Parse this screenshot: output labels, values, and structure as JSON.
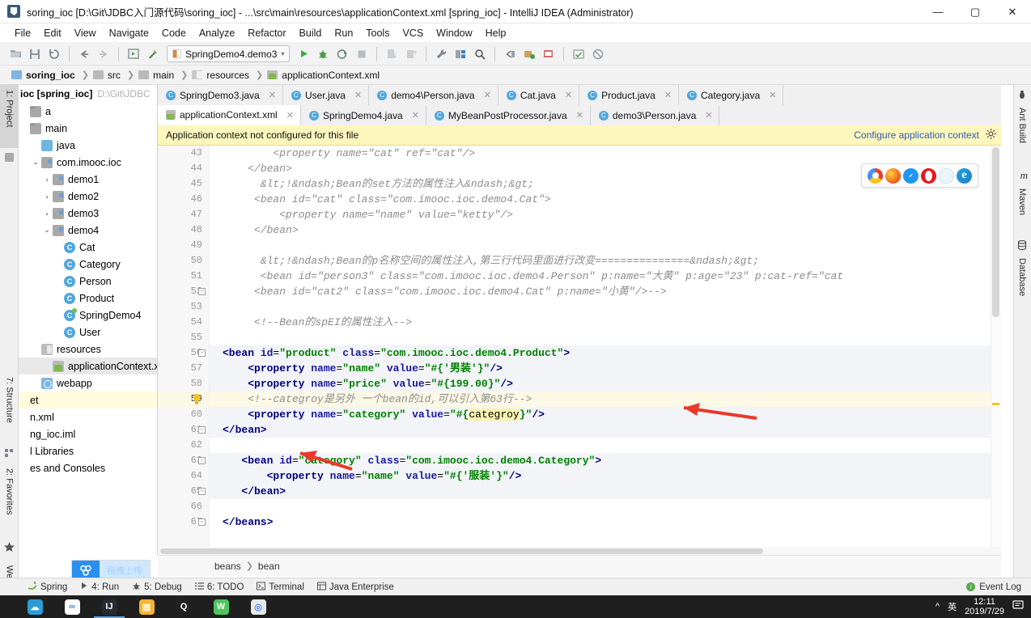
{
  "window": {
    "title": "soring_ioc [D:\\Git\\JDBC入门源代码\\soring_ioc] - ...\\src\\main\\resources\\applicationContext.xml [spring_ioc] - IntelliJ IDEA (Administrator)",
    "minimize": "—",
    "maximize": "▢",
    "close": "✕"
  },
  "menu": [
    {
      "label": "File"
    },
    {
      "label": "Edit"
    },
    {
      "label": "View"
    },
    {
      "label": "Navigate"
    },
    {
      "label": "Code"
    },
    {
      "label": "Analyze"
    },
    {
      "label": "Refactor"
    },
    {
      "label": "Build"
    },
    {
      "label": "Run"
    },
    {
      "label": "Tools"
    },
    {
      "label": "VCS"
    },
    {
      "label": "Window"
    },
    {
      "label": "Help"
    }
  ],
  "toolbar": {
    "open_icon": "open-folder-icon",
    "save_icon": "save-all-icon",
    "sync_icon": "sync-icon",
    "back_icon": "back-arrow-icon",
    "forward_icon": "forward-arrow-icon",
    "run_config_label": "SpringDemo4.demo3",
    "run_label": "▶",
    "debug_label": "debug-icon",
    "run_coverage_label": "run-coverage-icon",
    "stop_label": "■",
    "search_label": "search-icon"
  },
  "breadcrumb": [
    {
      "label": "soring_ioc",
      "icon": "module-icon",
      "bold": true
    },
    {
      "label": "src",
      "icon": "folder-icon",
      "bold": false
    },
    {
      "label": "main",
      "icon": "folder-icon",
      "bold": false
    },
    {
      "label": "resources",
      "icon": "resources-folder-icon",
      "bold": false
    },
    {
      "label": "applicationContext.xml",
      "icon": "xml-file-icon",
      "bold": false
    }
  ],
  "left_tool_tabs": [
    {
      "label": "1: Project",
      "icon": "project-icon",
      "selected": true
    },
    {
      "label": "7: Structure",
      "icon": "structure-icon",
      "selected": false
    },
    {
      "label": "2: Favorites",
      "icon": "star-icon",
      "selected": false
    },
    {
      "label": "Web",
      "icon": "web-icon",
      "selected": false
    }
  ],
  "right_tool_tabs": [
    {
      "label": "Ant Build",
      "icon": "ant-icon"
    },
    {
      "label": "Maven",
      "icon": "maven-icon"
    },
    {
      "label": "Database",
      "icon": "database-icon"
    }
  ],
  "project_tree": {
    "header_name": "ioc [spring_ioc]",
    "header_path": "D:\\Git\\JDBC",
    "items": [
      {
        "label": "a",
        "indent": 0,
        "arrow": "",
        "icon": "folder-icon",
        "state": "none"
      },
      {
        "label": "main",
        "indent": 0,
        "arrow": "",
        "icon": "folder-icon",
        "state": "none"
      },
      {
        "label": "java",
        "indent": 1,
        "arrow": "",
        "icon": "source-folder-icon",
        "state": "none"
      },
      {
        "label": "com.imooc.ioc",
        "indent": 1,
        "arrow": "v",
        "icon": "package-icon",
        "state": "none"
      },
      {
        "label": "demo1",
        "indent": 2,
        "arrow": ">",
        "icon": "package-icon",
        "state": "none"
      },
      {
        "label": "demo2",
        "indent": 2,
        "arrow": ">",
        "icon": "package-icon",
        "state": "none"
      },
      {
        "label": "demo3",
        "indent": 2,
        "arrow": ">",
        "icon": "package-icon",
        "state": "none"
      },
      {
        "label": "demo4",
        "indent": 2,
        "arrow": "v",
        "icon": "package-icon",
        "state": "none"
      },
      {
        "label": "Cat",
        "indent": 3,
        "arrow": "",
        "icon": "java-class-icon",
        "state": "none"
      },
      {
        "label": "Category",
        "indent": 3,
        "arrow": "",
        "icon": "java-class-icon",
        "state": "none"
      },
      {
        "label": "Person",
        "indent": 3,
        "arrow": "",
        "icon": "java-class-icon",
        "state": "none"
      },
      {
        "label": "Product",
        "indent": 3,
        "arrow": "",
        "icon": "java-class-icon",
        "state": "none"
      },
      {
        "label": "SpringDemo4",
        "indent": 3,
        "arrow": "",
        "icon": "java-runnable-class-icon",
        "state": "none"
      },
      {
        "label": "User",
        "indent": 3,
        "arrow": "",
        "icon": "java-class-icon",
        "state": "none"
      },
      {
        "label": "resources",
        "indent": 1,
        "arrow": "",
        "icon": "resources-folder-icon",
        "state": "none"
      },
      {
        "label": "applicationContext.xml",
        "indent": 2,
        "arrow": "",
        "icon": "xml-file-icon",
        "state": "selected"
      },
      {
        "label": "webapp",
        "indent": 1,
        "arrow": "",
        "icon": "webapp-folder-icon",
        "state": "none"
      },
      {
        "label": "et",
        "indent": 0,
        "arrow": "",
        "icon": "none",
        "state": "highlight"
      },
      {
        "label": "n.xml",
        "indent": 0,
        "arrow": "",
        "icon": "none",
        "state": "none"
      },
      {
        "label": "ng_ioc.iml",
        "indent": 0,
        "arrow": "",
        "icon": "none",
        "state": "none"
      },
      {
        "label": "l Libraries",
        "indent": 0,
        "arrow": "",
        "icon": "none",
        "state": "none"
      },
      {
        "label": "es and Consoles",
        "indent": 0,
        "arrow": "",
        "icon": "none",
        "state": "none"
      }
    ]
  },
  "editor_tabs_row1": [
    {
      "label": "SpringDemo3.java",
      "icon": "java-runnable-class-icon",
      "active": false,
      "close": "✕"
    },
    {
      "label": "User.java",
      "icon": "java-class-icon",
      "active": false,
      "close": "✕"
    },
    {
      "label": "demo4\\Person.java",
      "icon": "java-class-icon",
      "active": false,
      "close": "✕"
    },
    {
      "label": "Cat.java",
      "icon": "java-class-icon",
      "active": false,
      "close": "✕"
    },
    {
      "label": "Product.java",
      "icon": "java-class-icon",
      "active": false,
      "close": "✕"
    },
    {
      "label": "Category.java",
      "icon": "java-class-icon",
      "active": false,
      "close": "✕"
    }
  ],
  "editor_tabs_row2": [
    {
      "label": "applicationContext.xml",
      "icon": "xml-file-icon",
      "active": true,
      "close": "✕"
    },
    {
      "label": "SpringDemo4.java",
      "icon": "java-runnable-class-icon",
      "active": false,
      "close": "✕"
    },
    {
      "label": "MyBeanPostProcessor.java",
      "icon": "java-class-icon",
      "active": false,
      "close": "✕"
    },
    {
      "label": "demo3\\Person.java",
      "icon": "java-class-icon",
      "active": false,
      "close": "✕"
    }
  ],
  "notification": {
    "message": "Application context not configured for this file",
    "action": "Configure application context",
    "gear_icon": "gear-icon"
  },
  "browsers": [
    {
      "name": "chrome-icon"
    },
    {
      "name": "firefox-icon"
    },
    {
      "name": "safari-icon"
    },
    {
      "name": "opera-icon"
    },
    {
      "name": "light-browser-icon"
    },
    {
      "name": "edge-icon"
    }
  ],
  "code": {
    "first_line": 43,
    "lines": [
      {
        "n": 43,
        "state": "normal",
        "fold": "",
        "bulb": false,
        "tokens": [
          {
            "t": "        ",
            "c": "ind"
          },
          {
            "t": "<property",
            "c": "cmt"
          },
          {
            "t": " name=\"cat\" ref=\"cat\"/>",
            "c": "cmt"
          }
        ]
      },
      {
        "n": 44,
        "state": "normal",
        "fold": "",
        "bulb": false,
        "tokens": [
          {
            "t": "    ",
            "c": "ind"
          },
          {
            "t": "</bean>",
            "c": "cmt"
          }
        ]
      },
      {
        "n": 45,
        "state": "normal",
        "fold": "",
        "bulb": false,
        "tokens": [
          {
            "t": "      ",
            "c": "ind"
          },
          {
            "t": "&lt;!&ndash;Bean的set方法的属性注入&ndash;&gt;",
            "c": "cmt"
          }
        ]
      },
      {
        "n": 46,
        "state": "normal",
        "fold": "",
        "bulb": false,
        "tokens": [
          {
            "t": "     ",
            "c": "ind"
          },
          {
            "t": "<bean id=\"cat\" class=\"com.imooc.ioc.demo4.Cat\">",
            "c": "cmt"
          }
        ]
      },
      {
        "n": 47,
        "state": "normal",
        "fold": "",
        "bulb": false,
        "tokens": [
          {
            "t": "         ",
            "c": "ind"
          },
          {
            "t": "<property name=\"name\" value=\"ketty\"/>",
            "c": "cmt"
          }
        ]
      },
      {
        "n": 48,
        "state": "normal",
        "fold": "",
        "bulb": false,
        "tokens": [
          {
            "t": "     ",
            "c": "ind"
          },
          {
            "t": "</bean>",
            "c": "cmt"
          }
        ]
      },
      {
        "n": 49,
        "state": "normal",
        "fold": "",
        "bulb": false,
        "tokens": []
      },
      {
        "n": 50,
        "state": "normal",
        "fold": "",
        "bulb": false,
        "tokens": [
          {
            "t": "      ",
            "c": "ind"
          },
          {
            "t": "&lt;!&ndash;Bean的p名称空间的属性注入,第三行代码里面进行改变===============&ndash;&gt;",
            "c": "cmt"
          }
        ]
      },
      {
        "n": 51,
        "state": "normal",
        "fold": "",
        "bulb": false,
        "tokens": [
          {
            "t": "      ",
            "c": "ind"
          },
          {
            "t": "<bean id=\"person3\" class=\"com.imooc.ioc.demo4.Person\" p:name=\"大黄\" p:age=\"23\" p:cat-ref=\"cat",
            "c": "cmt"
          }
        ]
      },
      {
        "n": 52,
        "state": "normal",
        "fold": "-",
        "bulb": false,
        "tokens": [
          {
            "t": "     ",
            "c": "ind"
          },
          {
            "t": "<bean id=\"cat2\" class=\"com.imooc.ioc.demo4.Cat\" p:name=\"小黄\"/>-->",
            "c": "cmt"
          }
        ]
      },
      {
        "n": 53,
        "state": "normal",
        "fold": "",
        "bulb": false,
        "tokens": []
      },
      {
        "n": 54,
        "state": "normal",
        "fold": "",
        "bulb": false,
        "tokens": [
          {
            "t": "     ",
            "c": "ind"
          },
          {
            "t": "<!--Bean的spEI的属性注入-->",
            "c": "cmt"
          }
        ]
      },
      {
        "n": 55,
        "state": "normal",
        "fold": "",
        "bulb": false,
        "tokens": []
      },
      {
        "n": 56,
        "state": "selbg",
        "fold": "-",
        "bulb": false,
        "tokens": [
          {
            "t": "<bean",
            "c": "tag"
          },
          {
            "t": " id",
            "c": "attr"
          },
          {
            "t": "=",
            "c": "plain"
          },
          {
            "t": "\"product\"",
            "c": "str"
          },
          {
            "t": " class",
            "c": "attr"
          },
          {
            "t": "=",
            "c": "plain"
          },
          {
            "t": "\"com.imooc.ioc.demo4.Product\"",
            "c": "str"
          },
          {
            "t": ">",
            "c": "tag"
          }
        ]
      },
      {
        "n": 57,
        "state": "selbg",
        "fold": "",
        "bulb": false,
        "tokens": [
          {
            "t": "    ",
            "c": "ind"
          },
          {
            "t": "<property",
            "c": "tag"
          },
          {
            "t": " name",
            "c": "attr"
          },
          {
            "t": "=",
            "c": "plain"
          },
          {
            "t": "\"name\"",
            "c": "str"
          },
          {
            "t": " value",
            "c": "attr"
          },
          {
            "t": "=",
            "c": "plain"
          },
          {
            "t": "\"#{'男装'}\"",
            "c": "str"
          },
          {
            "t": "/>",
            "c": "tag"
          }
        ]
      },
      {
        "n": 58,
        "state": "selbg",
        "fold": "",
        "bulb": false,
        "tokens": [
          {
            "t": "    ",
            "c": "ind"
          },
          {
            "t": "<property",
            "c": "tag"
          },
          {
            "t": " name",
            "c": "attr"
          },
          {
            "t": "=",
            "c": "plain"
          },
          {
            "t": "\"price\"",
            "c": "str"
          },
          {
            "t": " value",
            "c": "attr"
          },
          {
            "t": "=",
            "c": "plain"
          },
          {
            "t": "\"#{199.00}\"",
            "c": "str"
          },
          {
            "t": "/>",
            "c": "tag"
          }
        ]
      },
      {
        "n": 59,
        "state": "hl",
        "fold": "",
        "bulb": true,
        "tokens": [
          {
            "t": "    ",
            "c": "ind"
          },
          {
            "t": "<!--categroy是另外 一个bean的id,可以引入第63行-->",
            "c": "cmt"
          }
        ]
      },
      {
        "n": 60,
        "state": "selbg",
        "fold": "",
        "bulb": false,
        "tokens": [
          {
            "t": "    ",
            "c": "ind"
          },
          {
            "t": "<property",
            "c": "tag"
          },
          {
            "t": " name",
            "c": "attr"
          },
          {
            "t": "=",
            "c": "plain"
          },
          {
            "t": "\"category\"",
            "c": "str"
          },
          {
            "t": " value",
            "c": "attr"
          },
          {
            "t": "=",
            "c": "plain"
          },
          {
            "t": "\"#{",
            "c": "str"
          },
          {
            "t": "categroy",
            "c": "mark"
          },
          {
            "t": "}\"",
            "c": "str"
          },
          {
            "t": "/>",
            "c": "tag"
          }
        ]
      },
      {
        "n": 61,
        "state": "selbg",
        "fold": "-",
        "bulb": false,
        "tokens": [
          {
            "t": "</bean>",
            "c": "tag"
          }
        ]
      },
      {
        "n": 62,
        "state": "normal",
        "fold": "",
        "bulb": false,
        "tokens": []
      },
      {
        "n": 63,
        "state": "selbg",
        "fold": "-",
        "bulb": false,
        "tokens": [
          {
            "t": "   ",
            "c": "ind"
          },
          {
            "t": "<bean",
            "c": "tag"
          },
          {
            "t": " id",
            "c": "attr"
          },
          {
            "t": "=",
            "c": "plain"
          },
          {
            "t": "\"category\"",
            "c": "str"
          },
          {
            "t": " class",
            "c": "attr"
          },
          {
            "t": "=",
            "c": "plain"
          },
          {
            "t": "\"com.imooc.ioc.demo4.Category\"",
            "c": "str"
          },
          {
            "t": ">",
            "c": "tag"
          }
        ]
      },
      {
        "n": 64,
        "state": "selbg",
        "fold": "",
        "bulb": false,
        "tokens": [
          {
            "t": "       ",
            "c": "ind"
          },
          {
            "t": "<property",
            "c": "tag"
          },
          {
            "t": " name",
            "c": "attr"
          },
          {
            "t": "=",
            "c": "plain"
          },
          {
            "t": "\"name\"",
            "c": "str"
          },
          {
            "t": " value",
            "c": "attr"
          },
          {
            "t": "=",
            "c": "plain"
          },
          {
            "t": "\"#{'服装'}\"",
            "c": "str"
          },
          {
            "t": "/>",
            "c": "tag"
          }
        ]
      },
      {
        "n": 65,
        "state": "selbg",
        "fold": "-",
        "bulb": false,
        "tokens": [
          {
            "t": "   ",
            "c": "ind"
          },
          {
            "t": "</bean>",
            "c": "tag"
          }
        ]
      },
      {
        "n": 66,
        "state": "normal",
        "fold": "",
        "bulb": false,
        "tokens": []
      },
      {
        "n": 67,
        "state": "normal",
        "fold": "-",
        "bulb": false,
        "tokens": [
          {
            "t": "</beans>",
            "c": "tag"
          }
        ]
      }
    ]
  },
  "editor_breadcrumb": [
    {
      "label": "beans"
    },
    {
      "label": "bean"
    }
  ],
  "bottom_tools": [
    {
      "label": "Spring",
      "icon": "spring-icon"
    },
    {
      "label": "4: Run",
      "icon": "run-icon"
    },
    {
      "label": "5: Debug",
      "icon": "debug-icon"
    },
    {
      "label": "6: TODO",
      "icon": "todo-icon"
    },
    {
      "label": "Terminal",
      "icon": "terminal-icon"
    },
    {
      "label": "Java Enterprise",
      "icon": "java-enterprise-icon"
    }
  ],
  "event_log": {
    "label": "Event Log",
    "badge_icon": "info-badge-icon"
  },
  "netdisk": {
    "icon": "baidu-netdisk-icon",
    "label": "拖拽上传"
  },
  "taskbar": {
    "items": [
      {
        "name": "cloud-icon",
        "glyph": "☁",
        "bg": "#2c9cd6",
        "active": false
      },
      {
        "name": "baidu-netdisk-icon",
        "glyph": "∞",
        "bg": "#ffffff",
        "fg": "#2a8ff0",
        "active": false
      },
      {
        "name": "intellij-idea-icon",
        "glyph": "IJ",
        "bg": "#262a33",
        "active": true
      },
      {
        "name": "file-explorer-icon",
        "glyph": "▤",
        "bg": "#f2b632",
        "active": false
      },
      {
        "name": "qq-icon",
        "glyph": "Q",
        "bg": "#222222",
        "active": false
      },
      {
        "name": "wechat-icon",
        "glyph": "W",
        "bg": "#4ec55d",
        "active": false
      },
      {
        "name": "chrome-icon",
        "glyph": "◎",
        "bg": "#e8e8e8",
        "fg": "#4a8cf7",
        "active": false
      }
    ],
    "tray": {
      "chevron": "^",
      "ime": "英",
      "time": "12:11",
      "date": "2019/7/29",
      "notify_icon": "notification-icon"
    }
  },
  "colors": {
    "accent": "#2a5db0",
    "notif_bg": "#fdf6bd",
    "tag": "#000080",
    "string": "#008000",
    "comment": "#8c8c8c",
    "highlight": "#fdf3b0",
    "arrow_red": "#e8392a"
  }
}
